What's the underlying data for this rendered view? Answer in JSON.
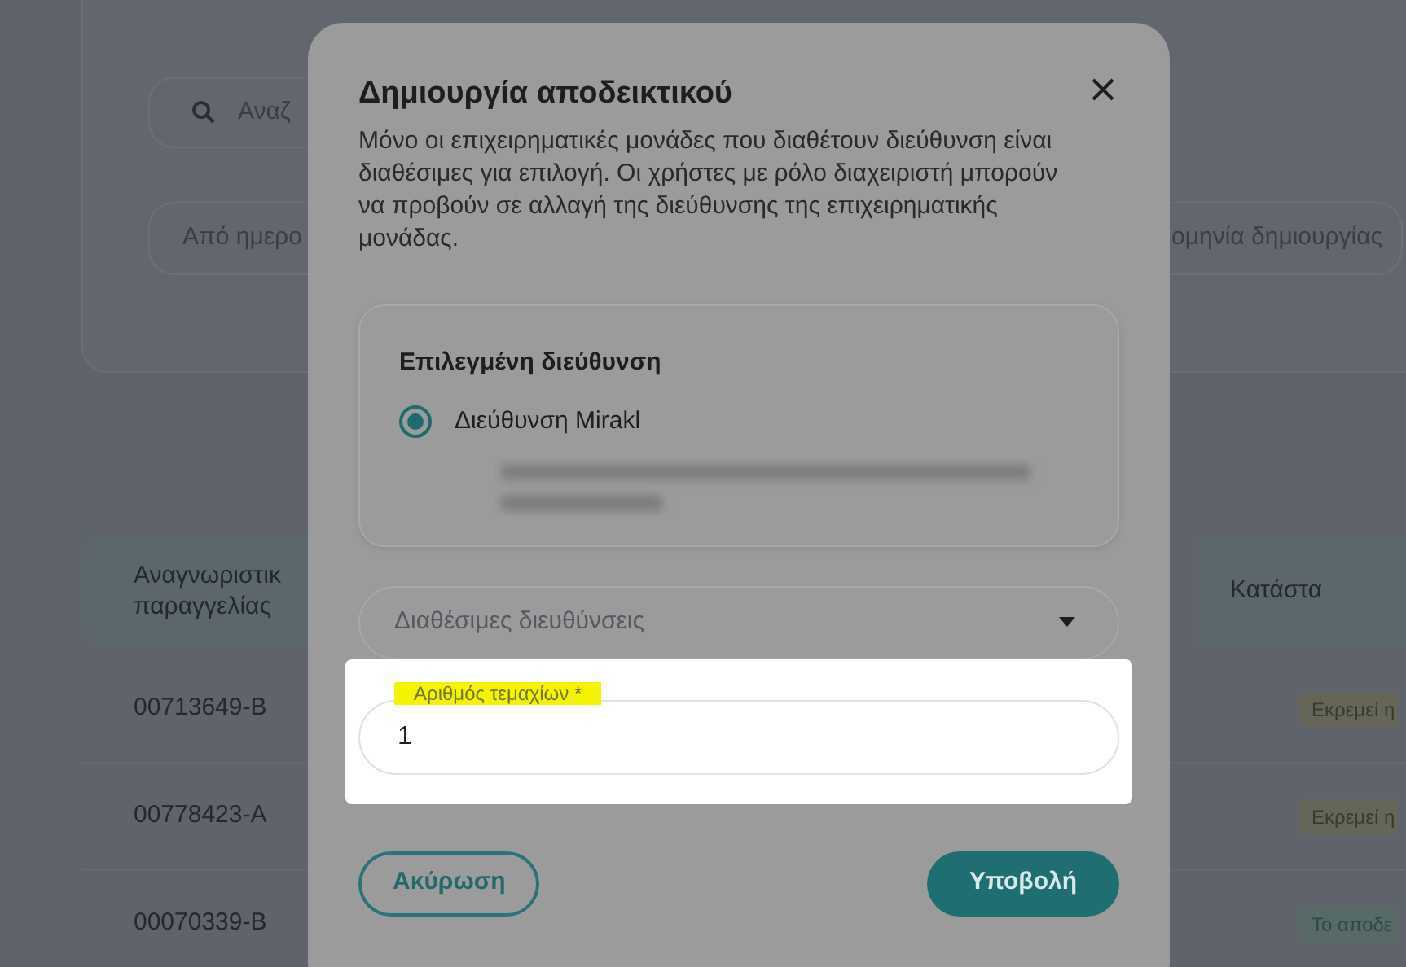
{
  "background": {
    "search": {
      "placeholder": "Αναζ"
    },
    "date_from": {
      "placeholder": "Από ημερο"
    },
    "date_created": {
      "placeholder": "ομηνία δημιουργίας"
    },
    "table": {
      "columns": [
        "Αναγνωριστικ\nπαραγγελίας",
        "Κατάστα"
      ],
      "rows": [
        {
          "id": "00713649-B",
          "status": "Εκρεμεί η",
          "kind": "pending"
        },
        {
          "id": "00778423-A",
          "status": "Εκρεμεί η",
          "kind": "pending"
        },
        {
          "id": "00070339-B",
          "status": "Το αποδε",
          "kind": "done"
        }
      ]
    }
  },
  "dialog": {
    "title": "Δημιουργία αποδεικτικού",
    "description": "Μόνο οι επιχειρηματικές μονάδες που διαθέτουν διεύθυνση είναι διαθέσιμες για επιλογή. Οι χρήστες με ρόλο διαχειριστή μπορούν να προβούν σε αλλαγή της διεύθυνσης της επιχειρηματικής μονάδας.",
    "selected_address": {
      "heading": "Επιλεγμένη διεύθυνση",
      "option": {
        "label": "Διεύθυνση Mirakl",
        "selected": true
      }
    },
    "addresses_dropdown": {
      "placeholder": "Διαθέσιμες διευθύνσεις"
    },
    "quantity_field": {
      "label": "Αριθμός τεμαχίων *",
      "value": "1",
      "highlighted": true
    },
    "buttons": [
      {
        "label": "Ακύρωση",
        "kind": "outline"
      },
      {
        "label": "Υποβολή",
        "kind": "filled"
      }
    ]
  }
}
